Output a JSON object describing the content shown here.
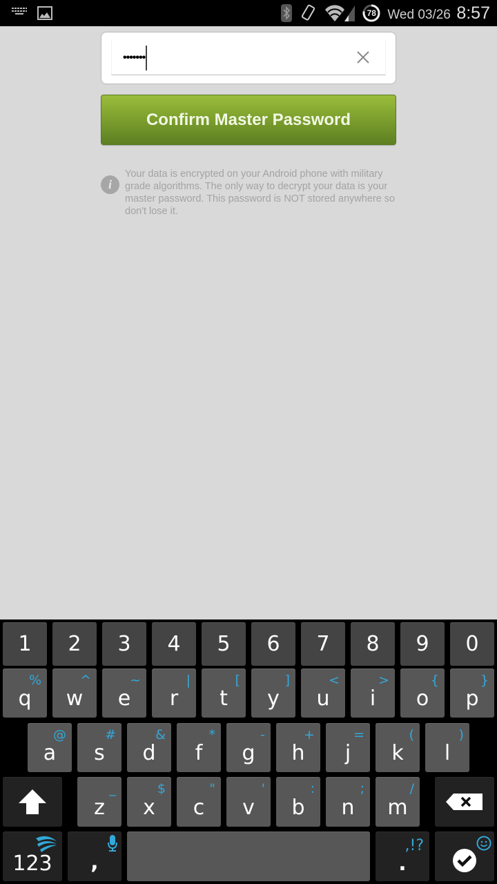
{
  "status_bar": {
    "left_icons": [
      "keyboard-icon",
      "image-icon"
    ],
    "right_icons": [
      "bluetooth-icon",
      "rotation-icon",
      "wifi-icon",
      "signal-icon",
      "battery-icon"
    ],
    "battery_level": "78",
    "date": "Wed 03/26",
    "time": "8:57"
  },
  "password_form": {
    "value": "•••••••",
    "clear_icon": "close-icon",
    "confirm_label": "Confirm Master Password",
    "info_icon": "info-icon",
    "info_glyph": "i",
    "info_text": "Your data is encrypted on your Android phone with military grade algorithms. The only way to decrypt your data is your master password. This password is NOT stored anywhere so don't lose it."
  },
  "colors": {
    "accent_green": "#7ea12e",
    "keyboard_hint": "#33a8d9",
    "background": "#d9d9d9"
  },
  "keyboard": {
    "number_row": [
      "1",
      "2",
      "3",
      "4",
      "5",
      "6",
      "7",
      "8",
      "9",
      "0"
    ],
    "row1": [
      {
        "key": "q",
        "alt": "%"
      },
      {
        "key": "w",
        "alt": "^"
      },
      {
        "key": "e",
        "alt": "~"
      },
      {
        "key": "r",
        "alt": "|"
      },
      {
        "key": "t",
        "alt": "["
      },
      {
        "key": "y",
        "alt": "]"
      },
      {
        "key": "u",
        "alt": "<"
      },
      {
        "key": "i",
        "alt": ">"
      },
      {
        "key": "o",
        "alt": "{"
      },
      {
        "key": "p",
        "alt": "}"
      }
    ],
    "row2": [
      {
        "key": "a",
        "alt": "@"
      },
      {
        "key": "s",
        "alt": "#"
      },
      {
        "key": "d",
        "alt": "&"
      },
      {
        "key": "f",
        "alt": "*"
      },
      {
        "key": "g",
        "alt": "-"
      },
      {
        "key": "h",
        "alt": "+"
      },
      {
        "key": "j",
        "alt": "="
      },
      {
        "key": "k",
        "alt": "("
      },
      {
        "key": "l",
        "alt": ")"
      }
    ],
    "row3": [
      {
        "key": "z",
        "alt": "_"
      },
      {
        "key": "x",
        "alt": "$"
      },
      {
        "key": "c",
        "alt": "\""
      },
      {
        "key": "v",
        "alt": "'"
      },
      {
        "key": "b",
        "alt": ":"
      },
      {
        "key": "n",
        "alt": ";"
      },
      {
        "key": "m",
        "alt": "/"
      }
    ],
    "bottom": {
      "symbols_label": "123",
      "comma_label": ",",
      "period_label": ".",
      "period_alt": ",!?",
      "space_label": ""
    }
  }
}
